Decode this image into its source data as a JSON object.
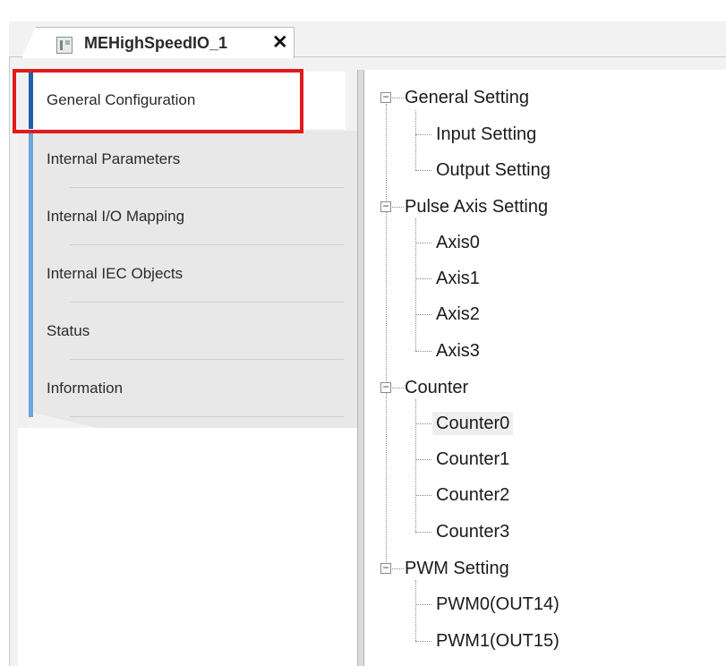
{
  "tab": {
    "title": "MEHighSpeedIO_1",
    "close": "✕",
    "icon": "device-module-icon"
  },
  "nav": {
    "items": [
      {
        "label": "General Configuration",
        "active": true
      },
      {
        "label": "Internal Parameters"
      },
      {
        "label": "Internal I/O Mapping"
      },
      {
        "label": "Internal IEC Objects"
      },
      {
        "label": "Status"
      },
      {
        "label": "Information"
      }
    ]
  },
  "tree": {
    "groups": [
      {
        "label": "General Setting",
        "toggle": "−",
        "children": [
          "Input Setting",
          "Output Setting"
        ]
      },
      {
        "label": "Pulse Axis Setting",
        "toggle": "−",
        "children": [
          "Axis0",
          "Axis1",
          "Axis2",
          "Axis3"
        ]
      },
      {
        "label": "Counter",
        "toggle": "−",
        "children": [
          "Counter0",
          "Counter1",
          "Counter2",
          "Counter3"
        ]
      },
      {
        "label": "PWM Setting",
        "toggle": "−",
        "children": [
          "PWM0(OUT14)",
          "PWM1(OUT15)"
        ]
      }
    ],
    "selected": "Counter0"
  },
  "colors": {
    "highlight": "#e01b1b",
    "nav_accent": "#6aa7df",
    "nav_active_accent": "#1f5fa8"
  }
}
